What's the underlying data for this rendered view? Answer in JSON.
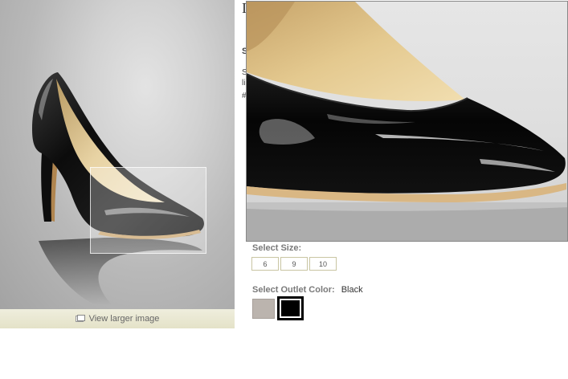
{
  "product": {
    "title_peek": "I",
    "detail_peek_1": "S",
    "detail_peek_2": "S",
    "detail_peek_3": "li",
    "detail_peek_4": "#"
  },
  "image": {
    "view_larger_label": "View larger image"
  },
  "size": {
    "label": "Select Size:",
    "options": [
      "6",
      "9",
      "10"
    ]
  },
  "color": {
    "label": "Select Outlet Color:",
    "selected": "Black",
    "swatches": [
      {
        "name": "taupe",
        "hex": "#bbb4ae"
      },
      {
        "name": "black",
        "hex": "#000000"
      }
    ]
  }
}
